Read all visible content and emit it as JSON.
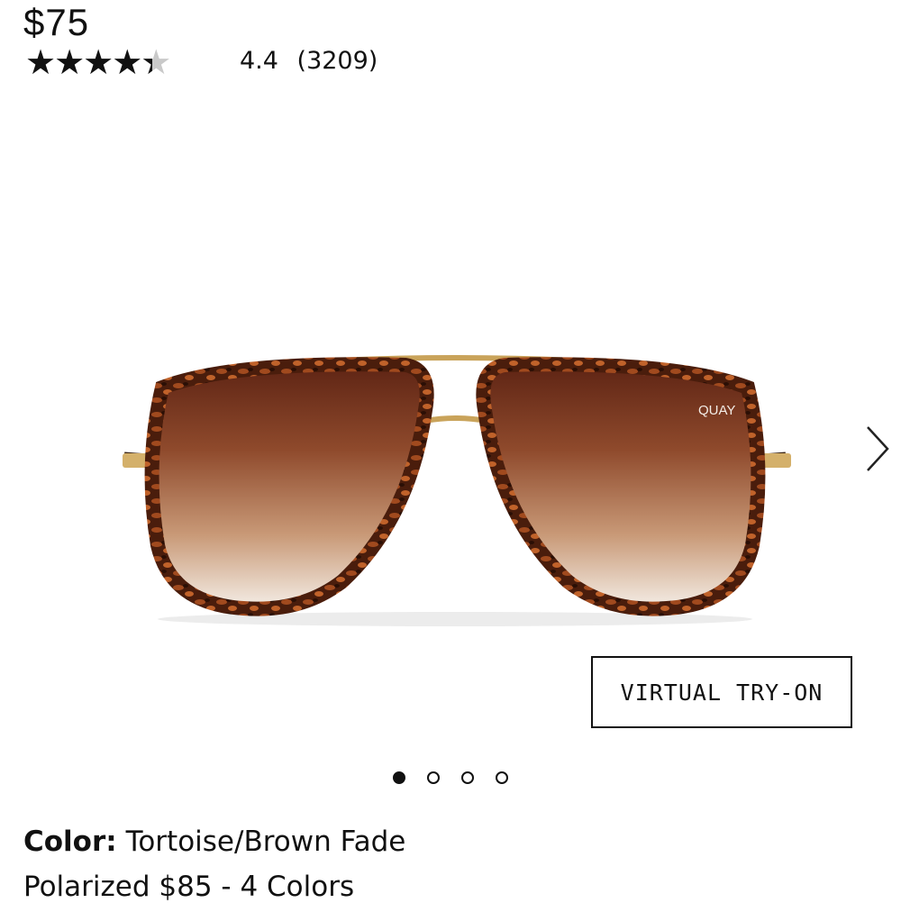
{
  "price": "$75",
  "rating": {
    "value": 4.4,
    "max": 5,
    "value_text": "4.4",
    "count_text": "(3209)"
  },
  "product": {
    "brand_mark": "QUAY",
    "icon": "sunglasses-image"
  },
  "carousel": {
    "next_icon": "chevron-right-icon",
    "slides": 4,
    "active_index": 0
  },
  "try_on": {
    "label": "VIRTUAL TRY-ON"
  },
  "color": {
    "label": "Color:",
    "value": "Tortoise/Brown Fade"
  },
  "variant_text": "Polarized $85 - 4 Colors",
  "colors": {
    "text": "#111111",
    "star_empty": "#c9c9c9",
    "lens_top": "#6b2d1b",
    "lens_bottom": "#f4eee6",
    "frame_gold": "#c9a35a",
    "tortoise": "#5a2a14"
  }
}
